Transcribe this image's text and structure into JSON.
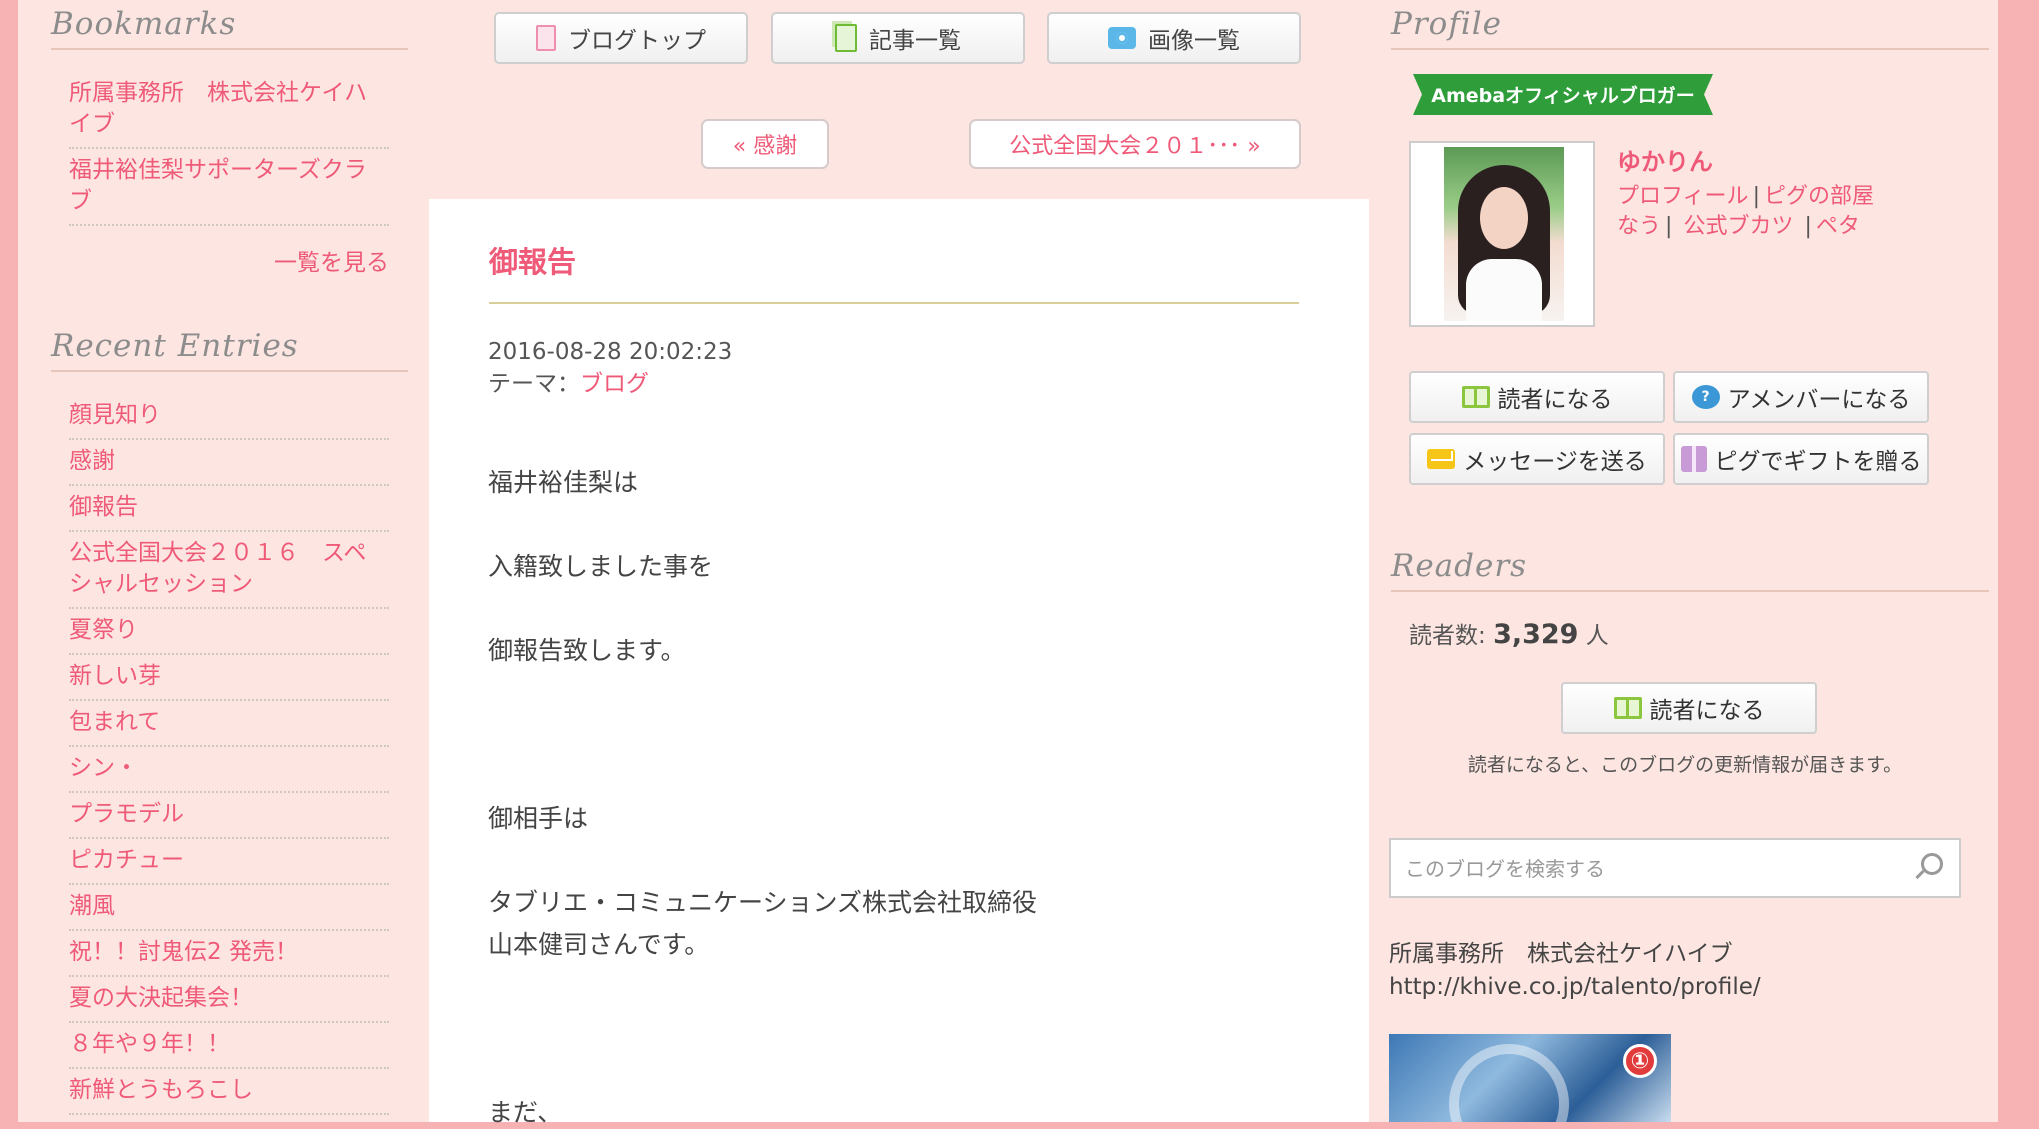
{
  "left": {
    "bookmarks_heading": "Bookmarks",
    "bookmarks": [
      {
        "line1": "所属事務所　株式会社ケイハ",
        "line2": "イブ"
      },
      {
        "line1": "福井裕佳梨サポーターズクラ",
        "line2": "ブ"
      }
    ],
    "see_all": "一覧を見る",
    "recent_heading": "Recent Entries",
    "recent": [
      {
        "line1": "顔見知り"
      },
      {
        "line1": "感謝"
      },
      {
        "line1": "御報告"
      },
      {
        "line1": "公式全国大会２０１６　スペ",
        "line2": "シャルセッション"
      },
      {
        "line1": "夏祭り"
      },
      {
        "line1": "新しい芽"
      },
      {
        "line1": "包まれて"
      },
      {
        "line1": "シン・"
      },
      {
        "line1": "プラモデル"
      },
      {
        "line1": "ピカチュー"
      },
      {
        "line1": "潮風"
      },
      {
        "line1": "祝！！討鬼伝2 発売！"
      },
      {
        "line1": "夏の大決起集会！"
      },
      {
        "line1": "８年や９年！！"
      },
      {
        "line1": "新鮮とうもろこし"
      }
    ]
  },
  "nav": {
    "blog_top": "ブログトップ",
    "entries": "記事一覧",
    "images": "画像一覧",
    "prev": "« 感謝",
    "next": "公式全国大会２０１･･･ »"
  },
  "article": {
    "title": "御報告",
    "date": "2016-08-28 20:02:23",
    "theme_label": "テーマ：",
    "theme": "ブログ",
    "lines": {
      "l1": "福井裕佳梨は",
      "l2": "入籍致しました事を",
      "l3": "御報告致します。",
      "l4": "御相手は",
      "l5": "タブリエ・コミュニケーションズ株式会社取締役",
      "l6": "山本健司さんです。",
      "l7": "まだ、"
    }
  },
  "right": {
    "profile_heading": "Profile",
    "badge": "Amebaオフィシャルブロガー",
    "name": "ゆかりん",
    "links": {
      "profile": "プロフィール",
      "pigg_room": "ピグの部屋",
      "now": "なう",
      "bukatsu": "公式ブカツ",
      "peta": "ペタ",
      "sep": "|"
    },
    "actions": {
      "reader": "読者になる",
      "amember": "アメンバーになる",
      "message": "メッセージを送る",
      "gift": "ピグでギフトを贈る"
    },
    "readers_heading": "Readers",
    "readers_label": "読者数:",
    "readers_count": "3,329",
    "readers_unit": "人",
    "reader_button": "読者になる",
    "reader_note": "読者になると、このブログの更新情報が届きます。",
    "search_placeholder": "このブログを検索する",
    "free_text_1": "所属事務所　株式会社ケイハイブ",
    "free_text_2": "http://khive.co.jp/talento/profile/",
    "comic_number": "①"
  },
  "colors": {
    "accent": "#ef5a78",
    "page_bg": "#fde6e1",
    "outer_bg": "#f7b3b3",
    "badge": "#2f9e3a"
  }
}
